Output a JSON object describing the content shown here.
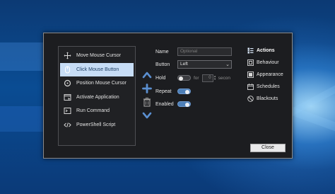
{
  "actions_list": {
    "items": [
      {
        "label": "Move Mouse Cursor",
        "icon": "move-cursor-icon",
        "selected": false
      },
      {
        "label": "Click Mouse Button",
        "icon": "mouse-icon",
        "selected": true
      },
      {
        "label": "Position Mouse Cursor",
        "icon": "target-icon",
        "selected": false
      },
      {
        "label": "Activate Application",
        "icon": "window-icon",
        "selected": false
      },
      {
        "label": "Run Command",
        "icon": "terminal-icon",
        "selected": false
      },
      {
        "label": "PowerShell Script",
        "icon": "code-icon",
        "selected": false
      }
    ]
  },
  "tools": {
    "up": "chevron-up-icon",
    "add": "plus-icon",
    "delete": "trash-icon",
    "down": "chevron-down-icon"
  },
  "form": {
    "name_label": "Name",
    "name_placeholder": "Optional",
    "name_value": "",
    "button_label": "Button",
    "button_value": "Left",
    "hold_label": "Hold",
    "hold_enabled": false,
    "for_text": "for",
    "hold_seconds": "0",
    "seconds_text": "secon",
    "repeat_label": "Repeat",
    "repeat_enabled": true,
    "enabled_label": "Enabled",
    "enabled_enabled": true
  },
  "nav": {
    "items": [
      {
        "label": "Actions",
        "icon": "list-icon",
        "active": true
      },
      {
        "label": "Behaviour",
        "icon": "behaviour-icon",
        "active": false
      },
      {
        "label": "Appearance",
        "icon": "appearance-icon",
        "active": false
      },
      {
        "label": "Schedules",
        "icon": "calendar-icon",
        "active": false
      },
      {
        "label": "Blackouts",
        "icon": "blackout-icon",
        "active": false
      }
    ]
  },
  "footer": {
    "close_label": "Close"
  },
  "colors": {
    "accent": "#4d7fb8",
    "selection": "#c7ddf6",
    "window_bg": "#1c1d20"
  }
}
